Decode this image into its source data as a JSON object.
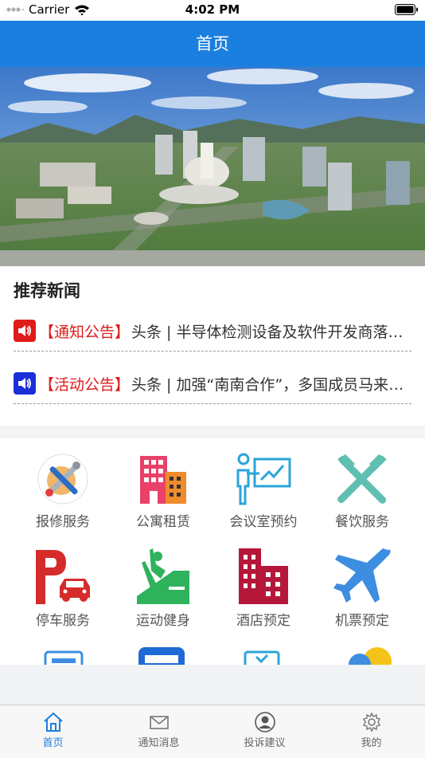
{
  "status": {
    "carrier": "Carrier",
    "time": "4:02 PM"
  },
  "nav": {
    "title": "首页"
  },
  "news": {
    "title": "推荐新闻",
    "items": [
      {
        "tag": "【通知公告】",
        "text": "头条 | 半导体检测设备及软件开发商落户高新区",
        "icon": "speaker-icon",
        "color": "#e01b1b"
      },
      {
        "tag": "【活动公告】",
        "text": "头条 | 加强“南南合作”，多国成员马来西亚",
        "icon": "speaker-icon",
        "color": "#1a2fd8"
      }
    ]
  },
  "services": [
    {
      "label": "报修服务",
      "icon": "repair-tools-icon"
    },
    {
      "label": "公寓租赁",
      "icon": "apartment-icon"
    },
    {
      "label": "会议室预约",
      "icon": "meeting-room-icon"
    },
    {
      "label": "餐饮服务",
      "icon": "fork-knife-icon"
    },
    {
      "label": "停车服务",
      "icon": "parking-icon"
    },
    {
      "label": "运动健身",
      "icon": "fitness-icon"
    },
    {
      "label": "酒店预定",
      "icon": "hotel-icon"
    },
    {
      "label": "机票预定",
      "icon": "airplane-icon"
    }
  ],
  "tabs": [
    {
      "label": "首页",
      "icon": "home-icon",
      "active": true
    },
    {
      "label": "通知消息",
      "icon": "mail-icon"
    },
    {
      "label": "投诉建议",
      "icon": "user-icon"
    },
    {
      "label": "我的",
      "icon": "gear-icon"
    }
  ],
  "colors": {
    "brand": "#1b7fe0",
    "tag": "#e01b1b"
  }
}
